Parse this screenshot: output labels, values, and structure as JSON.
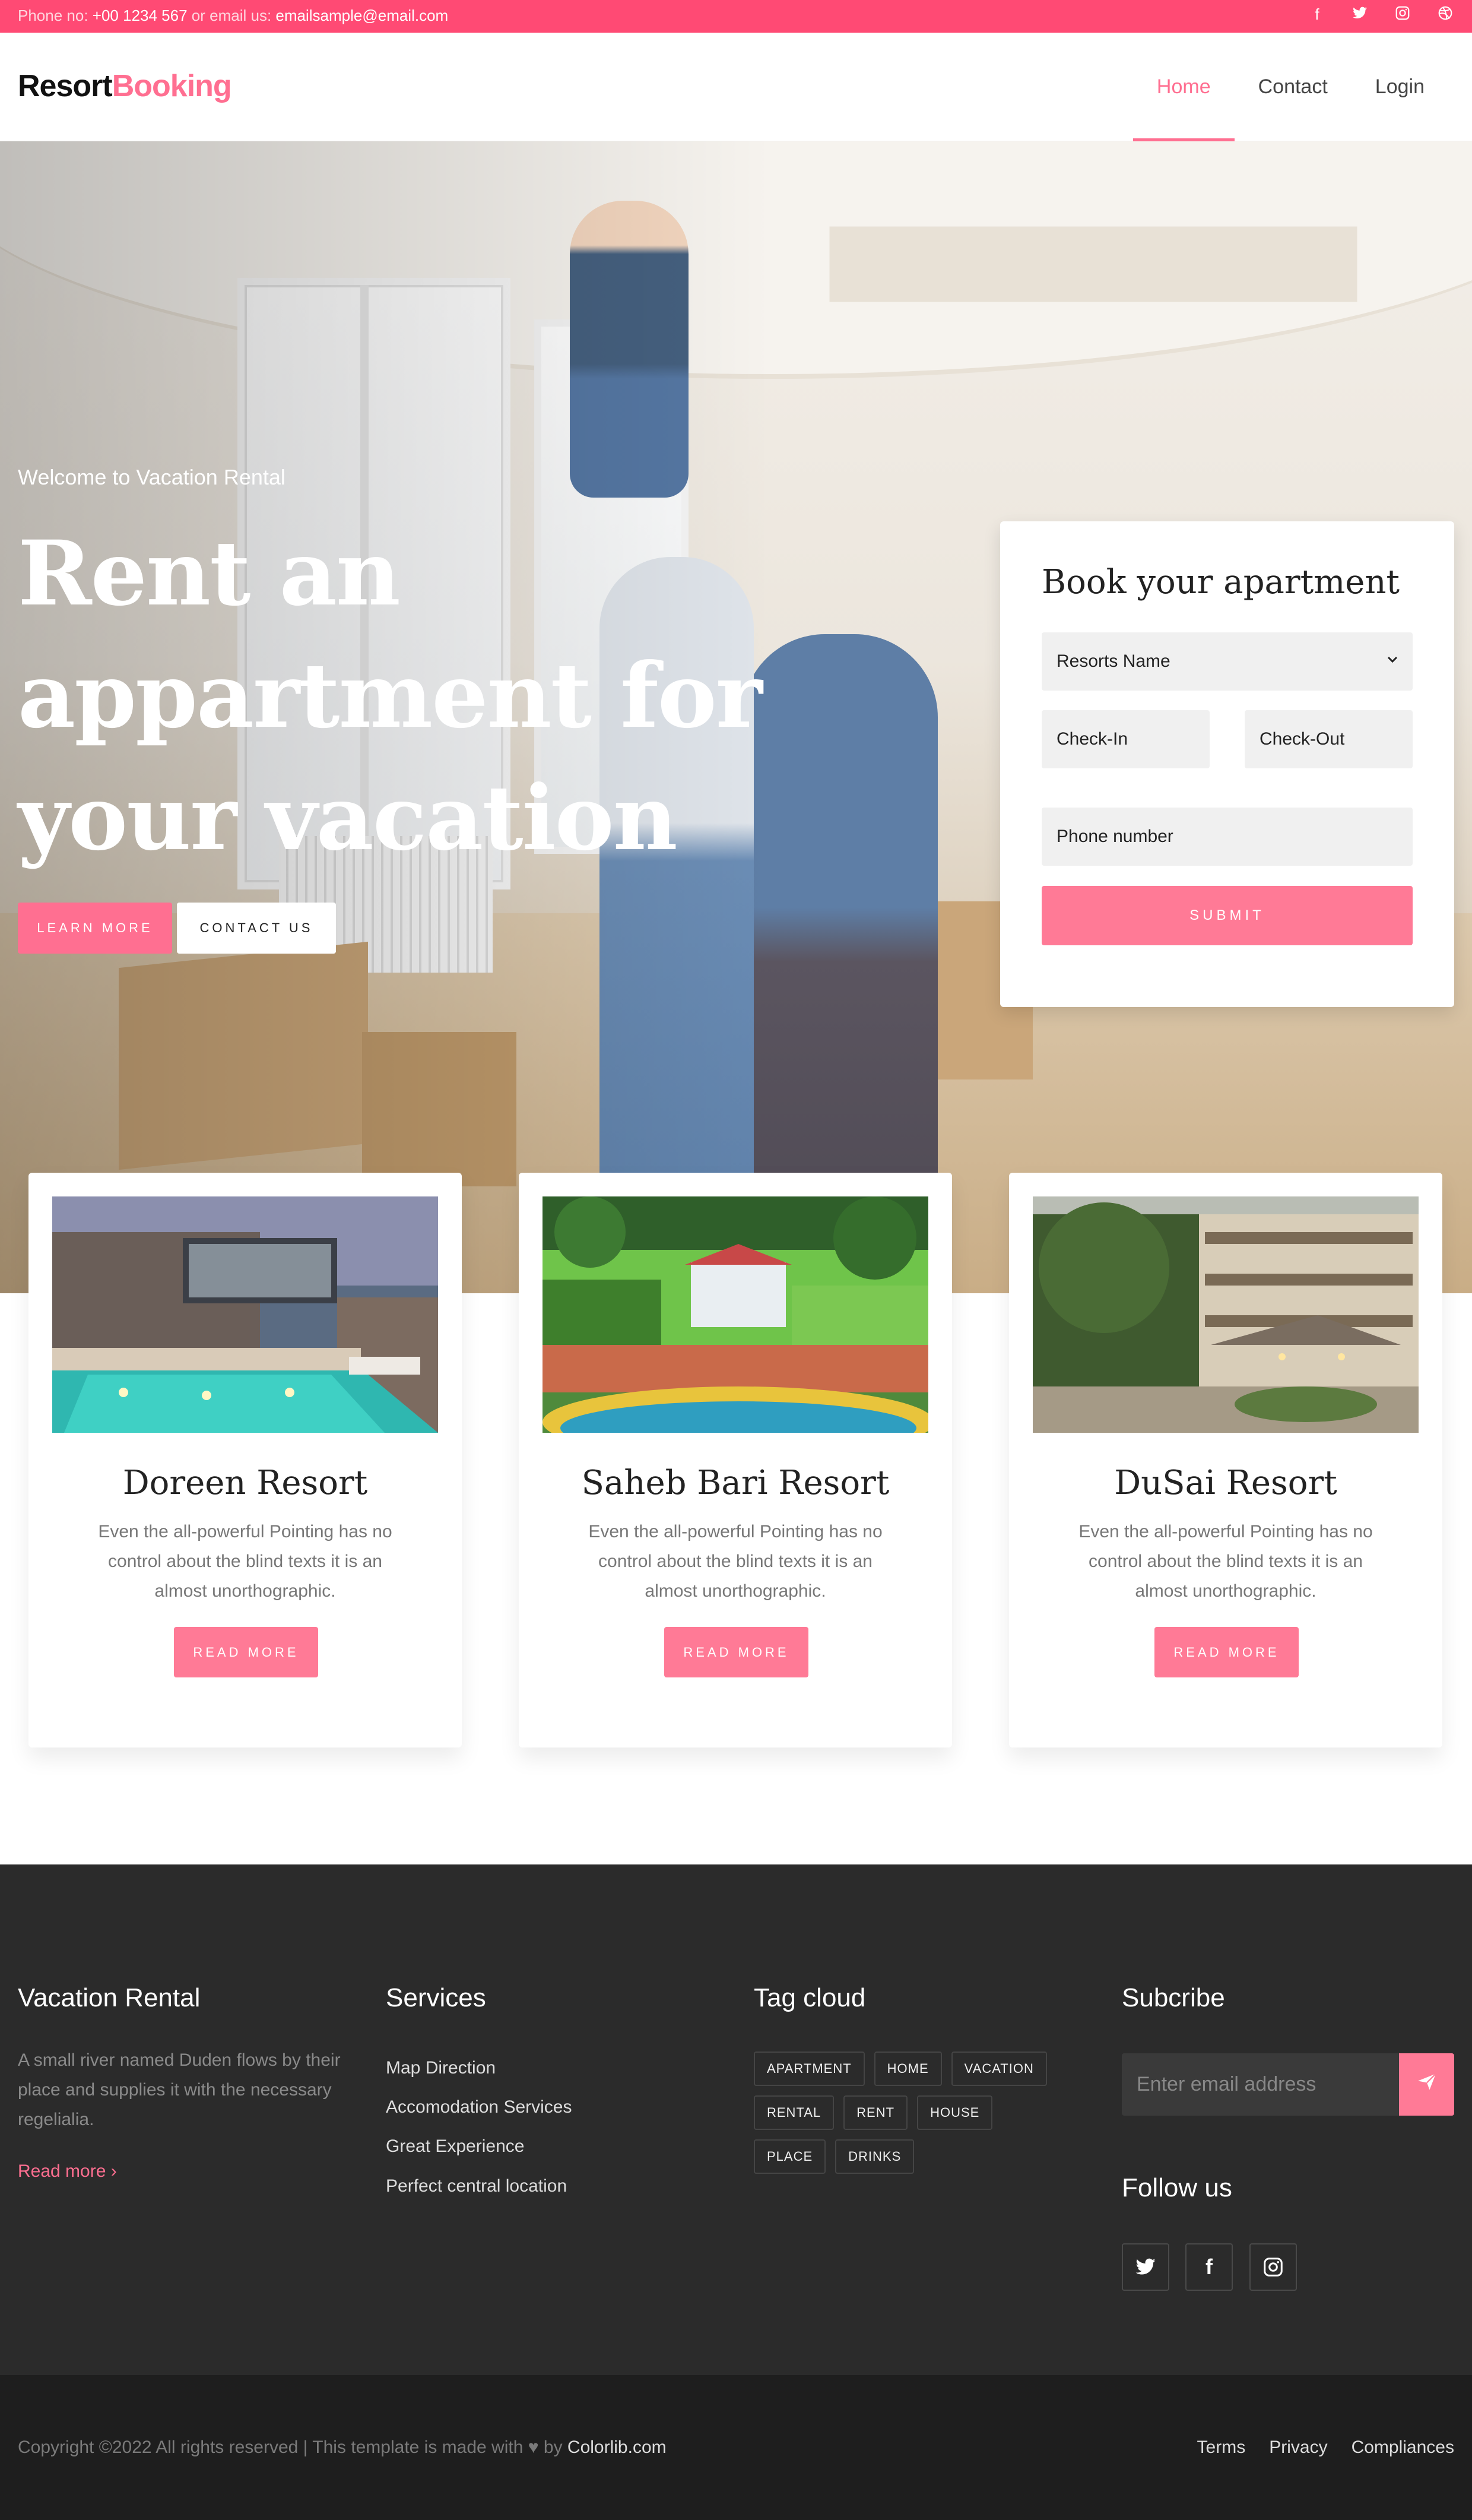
{
  "topbar": {
    "phone_prefix": "Phone no: ",
    "phone": "+00 1234 567",
    "email_prefix": " or email us: ",
    "email": "emailsample@email.com",
    "social_icons": [
      "facebook-icon",
      "twitter-icon",
      "instagram-icon",
      "dribbble-icon"
    ]
  },
  "brand": {
    "part1": "Resort",
    "part2": "Booking"
  },
  "nav": {
    "items": [
      {
        "label": "Home",
        "active": true
      },
      {
        "label": "Contact"
      },
      {
        "label": "Login"
      }
    ]
  },
  "hero": {
    "welcome": "Welcome to Vacation Rental",
    "headline_line1": "Rent an",
    "headline_line2": "appartment for",
    "headline_line3": "your vacation",
    "learn_more": "LEARN MORE",
    "contact_us": "CONTACT US"
  },
  "booking": {
    "title": "Book your apartment",
    "resort_select": "Resorts Name",
    "checkin_placeholder": "Check-In",
    "checkout_placeholder": "Check-Out",
    "phone_placeholder": "Phone number",
    "submit": "SUBMIT"
  },
  "resorts": [
    {
      "name": "Doreen Resort",
      "description": "Even the all-powerful Pointing has no control about the blind texts it is an almost unorthographic.",
      "cta": "READ MORE"
    },
    {
      "name": "Saheb Bari Resort",
      "description": "Even the all-powerful Pointing has no control about the blind texts it is an almost unorthographic.",
      "cta": "READ MORE"
    },
    {
      "name": "DuSai Resort",
      "description": "Even the all-powerful Pointing has no control about the blind texts it is an almost unorthographic.",
      "cta": "READ MORE"
    }
  ],
  "footer": {
    "about": {
      "title": "Vacation Rental",
      "text": "A small river named Duden flows by their place and supplies it with the necessary regelialia.",
      "read_more": "Read more ›"
    },
    "services": {
      "title": "Services",
      "items": [
        "Map Direction",
        "Accomodation Services",
        "Great Experience",
        "Perfect central location"
      ]
    },
    "tags": {
      "title": "Tag cloud",
      "items": [
        "APARTMENT",
        "HOME",
        "VACATION",
        "RENTAL",
        "RENT",
        "HOUSE",
        "PLACE",
        "DRINKS"
      ]
    },
    "subscribe": {
      "title": "Subcribe",
      "placeholder": "Enter email address"
    },
    "follow": {
      "title": "Follow us",
      "icons": [
        "twitter-icon",
        "facebook-icon",
        "instagram-icon"
      ]
    }
  },
  "bottom": {
    "copyright": "Copyright ©2022 All rights reserved | This template is made with ",
    "copyright_by": " by ",
    "copyright_brand": "Colorlib.com",
    "links": [
      "Terms",
      "Privacy",
      "Compliances"
    ]
  },
  "colors": {
    "accent": "#ff6f91",
    "topbar": "#ff4a74",
    "footer": "#2b2b2b",
    "bottom": "#1e1e1e"
  }
}
